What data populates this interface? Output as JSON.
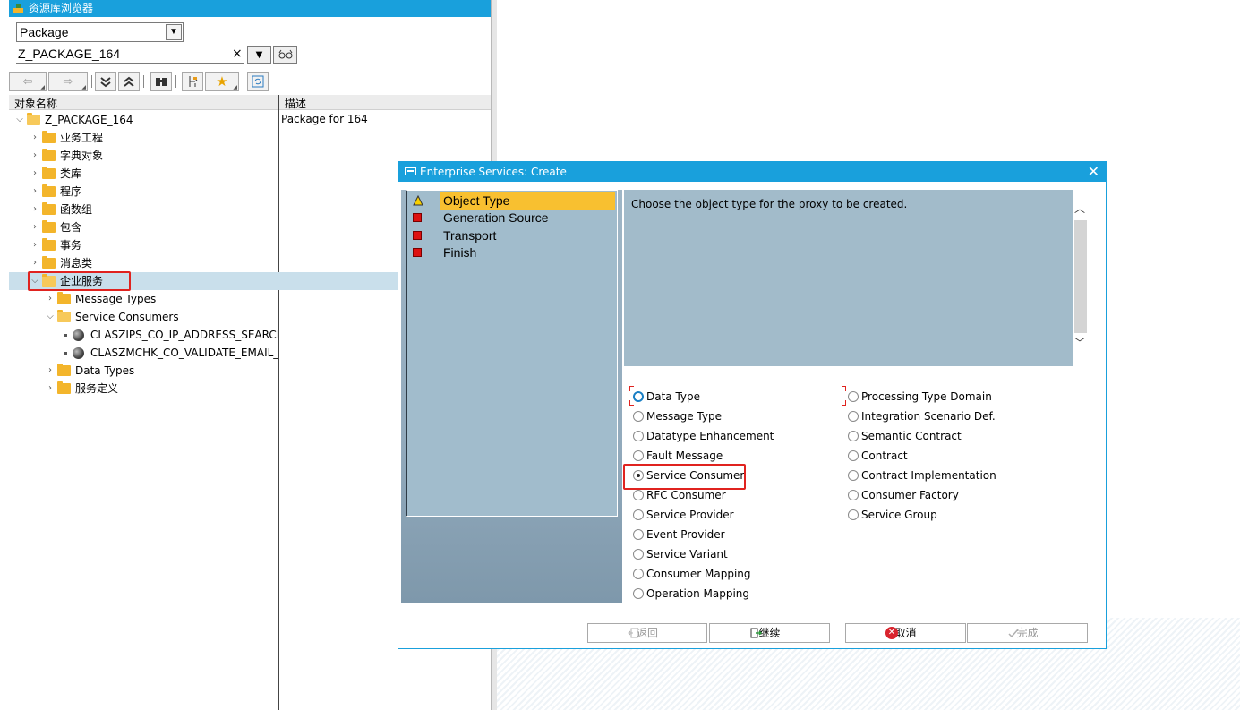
{
  "window_title": "资源库浏览器",
  "object_type_select": "Package",
  "object_name_input": "Z_PACKAGE_164",
  "columns": {
    "name": "对象名称",
    "description": "描述"
  },
  "root_description": "Package for 164",
  "tree": {
    "root": "Z_PACKAGE_164",
    "items": [
      "业务工程",
      "字典对象",
      "类库",
      "程序",
      "函数组",
      "包含",
      "事务",
      "消息类",
      "企业服务"
    ],
    "enterprise_children": [
      "Message Types",
      "Service Consumers",
      "Data Types",
      "服务定义"
    ],
    "consumers": [
      "CLASZIPS_CO_IP_ADDRESS_SEARCH_",
      "CLASZMCHK_CO_VALIDATE_EMAIL_W"
    ]
  },
  "dialog": {
    "title": "Enterprise Services: Create",
    "steps": [
      {
        "label": "Object Type",
        "status": "active"
      },
      {
        "label": "Generation Source",
        "status": "pending"
      },
      {
        "label": "Transport",
        "status": "pending"
      },
      {
        "label": "Finish",
        "status": "pending"
      }
    ],
    "info_text": "Choose the object type for the proxy to be created.",
    "options_left": [
      "Data Type",
      "Message Type",
      "Datatype Enhancement",
      "Fault Message",
      "Service Consumer",
      "RFC Consumer",
      "Service Provider",
      "Event Provider",
      "Service Variant",
      "Consumer Mapping",
      "Operation Mapping"
    ],
    "options_right": [
      "Processing Type Domain",
      "Integration Scenario Def.",
      "Semantic Contract",
      "Contract",
      "Contract Implementation",
      "Consumer Factory",
      "Service Group"
    ],
    "selected_option": "Service Consumer",
    "buttons": {
      "back": "返回",
      "continue": "继续",
      "cancel": "取消",
      "complete": "完成"
    }
  },
  "colors": {
    "title_bar": "#19a0dc",
    "active_step": "#f8c030",
    "panel": "#a2bbca",
    "highlight_box": "#e0231f"
  }
}
